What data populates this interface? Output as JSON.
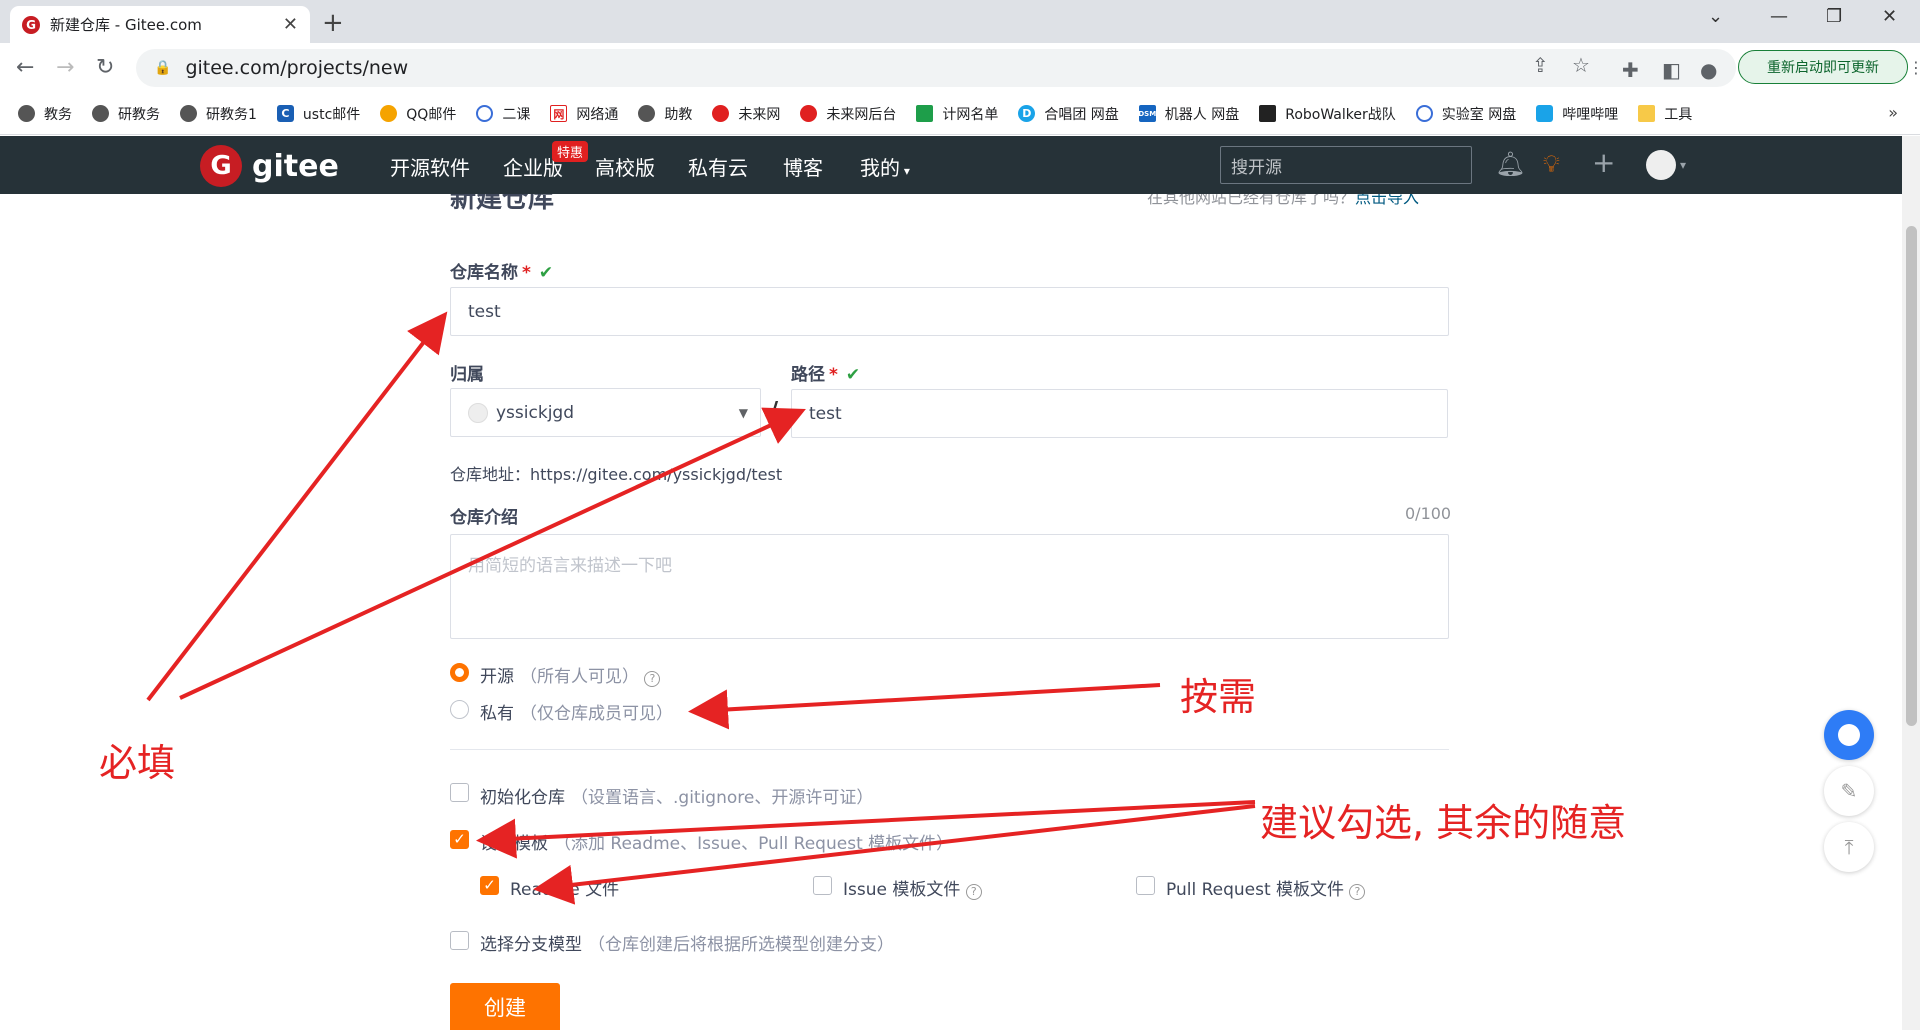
{
  "browser": {
    "tab_title": "新建仓库 - Gitee.com",
    "url": "gitee.com/projects/new",
    "relaunch_label": "重新启动即可更新",
    "bookmarks": [
      {
        "label": "教务",
        "icon": "globe-icon",
        "color": "#555"
      },
      {
        "label": "研教务",
        "icon": "globe-icon",
        "color": "#555"
      },
      {
        "label": "研教务1",
        "icon": "globe-icon",
        "color": "#555"
      },
      {
        "label": "ustc邮件",
        "icon": "c-icon",
        "color": "#1a5fb4"
      },
      {
        "label": "QQ邮件",
        "icon": "qq-mail-icon",
        "color": "#f5a300"
      },
      {
        "label": "二课",
        "icon": "circle-icon",
        "color": "#3a6ed8"
      },
      {
        "label": "网络通",
        "icon": "wang-icon",
        "color": "#e02020"
      },
      {
        "label": "助教",
        "icon": "globe-icon",
        "color": "#555"
      },
      {
        "label": "未来网",
        "icon": "red-gear-icon",
        "color": "#e02020"
      },
      {
        "label": "未来网后台",
        "icon": "red-gear-icon",
        "color": "#e02020"
      },
      {
        "label": "计网名单",
        "icon": "sheet-icon",
        "color": "#1e9e4a"
      },
      {
        "label": "合唱团 网盘",
        "icon": "d-icon",
        "color": "#1aa3e8"
      },
      {
        "label": "机器人 网盘",
        "icon": "dsm-icon",
        "color": "#1565c0"
      },
      {
        "label": "RoboWalker战队",
        "icon": "robo-icon",
        "color": "#222"
      },
      {
        "label": "实验室 网盘",
        "icon": "circle-icon",
        "color": "#3a6ed8"
      },
      {
        "label": "哔哩哔哩",
        "icon": "bilibili-icon",
        "color": "#1aa3e8"
      },
      {
        "label": "工具",
        "icon": "folder-icon",
        "color": "#f7c948"
      }
    ]
  },
  "gitee": {
    "logo_text": "gitee",
    "nav": [
      "开源软件",
      "企业版",
      "高校版",
      "私有云",
      "博客",
      "我的"
    ],
    "badge": "特惠",
    "search_placeholder": "搜开源"
  },
  "form": {
    "page_title": "新建仓库",
    "import_prompt": "在其他网站已经有仓库了吗？",
    "import_link": "点击导入",
    "repo_name_label": "仓库名称",
    "repo_name_value": "test",
    "owner_label": "归属",
    "owner_value": "yssickjgd",
    "path_label": "路径",
    "path_value": "test",
    "slash": "/",
    "repo_address": "仓库地址：https://gitee.com/yssickjgd/test",
    "intro_label": "仓库介绍",
    "intro_count": "0/100",
    "intro_placeholder": "用简短的语言来描述一下吧",
    "visibility": [
      {
        "label": "开源",
        "sub": "（所有人可见）",
        "checked": true
      },
      {
        "label": "私有",
        "sub": "（仅仓库成员可见）",
        "checked": false
      }
    ],
    "init_repo": {
      "label": "初始化仓库",
      "sub": "（设置语言、.gitignore、开源许可证）",
      "checked": false
    },
    "set_template": {
      "label": "设置模板",
      "sub": "（添加 Readme、Issue、Pull Request 模板文件）",
      "checked": true
    },
    "templates": [
      {
        "label": "Readme 文件",
        "checked": true
      },
      {
        "label": "Issue 模板文件",
        "checked": false
      },
      {
        "label": "Pull Request 模板文件",
        "checked": false
      }
    ],
    "branch_model": {
      "label": "选择分支模型",
      "sub": "（仓库创建后将根据所选模型创建分支）",
      "checked": false
    },
    "create_label": "创建"
  },
  "annotations": {
    "required": "必填",
    "as_needed": "按需",
    "suggest": "建议勾选, 其余的随意",
    "color": "#e52323"
  }
}
